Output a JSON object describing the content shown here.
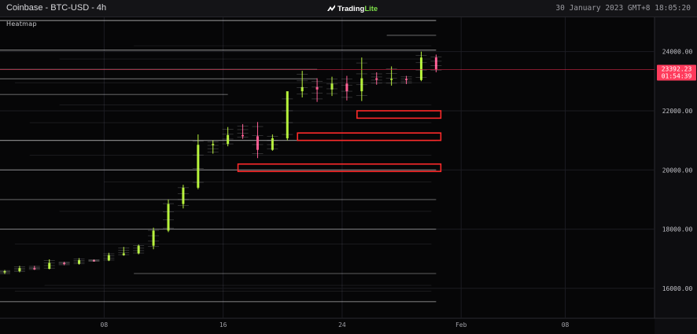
{
  "header": {
    "symbol": "Coinbase - BTC-USD - 4h",
    "logo_main": "Trading",
    "logo_accent": "Lite",
    "datetime": "30 January 2023 GMT+8 18:05:20"
  },
  "panel": {
    "title": "Heatmap"
  },
  "colors": {
    "background": "#0a0a0c",
    "up_candle": "#b6f23a",
    "down_candle": "#ff5c93",
    "highlight_box": "#ff2a2a",
    "price_line": "#d6284a",
    "current_price_bg": "#ff3b5c",
    "heat_line": "#e8e8e8"
  },
  "price_axis": {
    "ticks": [
      "24000.00",
      "22000.00",
      "20000.00",
      "18000.00",
      "16000.00"
    ],
    "current_price": "23392.23",
    "countdown": "01:54:39"
  },
  "time_axis": {
    "ticks": [
      "08",
      "16",
      "24",
      "Feb",
      "08"
    ]
  },
  "chart_data": {
    "type": "candlestick",
    "interval": "4h",
    "y_range": [
      15200,
      25000
    ],
    "x_range": [
      "2023-01-01",
      "2023-02-14"
    ],
    "current_price": 23392.23,
    "highlight_zones": [
      {
        "from": "2023-01-25",
        "to": "2023-01-30",
        "price_low": 21750,
        "price_high": 22000
      },
      {
        "from": "2023-01-21",
        "to": "2023-01-30",
        "price_low": 21000,
        "price_high": 21250
      },
      {
        "from": "2023-01-17",
        "to": "2023-01-30",
        "price_low": 19950,
        "price_high": 20200
      }
    ],
    "liquidity_levels": [
      {
        "price": 25050,
        "from": "2023-01-01",
        "to": "2023-01-30"
      },
      {
        "price": 24550,
        "from": "2023-01-27",
        "to": "2023-01-30"
      },
      {
        "price": 24050,
        "from": "2023-01-01",
        "to": "2023-01-30"
      },
      {
        "price": 23400,
        "from": "2023-01-01",
        "to": "2023-01-22"
      },
      {
        "price": 23080,
        "from": "2023-01-01",
        "to": "2023-01-22"
      },
      {
        "price": 22550,
        "from": "2023-01-01",
        "to": "2023-01-16"
      },
      {
        "price": 21000,
        "from": "2023-01-01",
        "to": "2023-01-30"
      },
      {
        "price": 20000,
        "from": "2023-01-01",
        "to": "2023-01-30"
      },
      {
        "price": 19000,
        "from": "2023-01-01",
        "to": "2023-01-30"
      },
      {
        "price": 18000,
        "from": "2023-01-01",
        "to": "2023-01-30"
      },
      {
        "price": 16500,
        "from": "2023-01-10",
        "to": "2023-01-30"
      },
      {
        "price": 15550,
        "from": "2023-01-01",
        "to": "2023-01-30"
      }
    ],
    "candles": [
      {
        "date": "2023-01-01",
        "o": 16540,
        "h": 16620,
        "l": 16480,
        "c": 16580
      },
      {
        "date": "2023-01-02",
        "o": 16580,
        "h": 16760,
        "l": 16540,
        "c": 16680
      },
      {
        "date": "2023-01-03",
        "o": 16680,
        "h": 16760,
        "l": 16620,
        "c": 16660
      },
      {
        "date": "2023-01-04",
        "o": 16660,
        "h": 16980,
        "l": 16640,
        "c": 16860
      },
      {
        "date": "2023-01-05",
        "o": 16860,
        "h": 16900,
        "l": 16780,
        "c": 16830
      },
      {
        "date": "2023-01-06",
        "o": 16830,
        "h": 17020,
        "l": 16800,
        "c": 16950
      },
      {
        "date": "2023-01-07",
        "o": 16950,
        "h": 16980,
        "l": 16900,
        "c": 16940
      },
      {
        "date": "2023-01-08",
        "o": 16940,
        "h": 17200,
        "l": 16920,
        "c": 17120
      },
      {
        "date": "2023-01-09",
        "o": 17120,
        "h": 17400,
        "l": 17100,
        "c": 17180
      },
      {
        "date": "2023-01-10",
        "o": 17180,
        "h": 17480,
        "l": 17150,
        "c": 17440
      },
      {
        "date": "2023-01-11",
        "o": 17440,
        "h": 18050,
        "l": 17320,
        "c": 17950
      },
      {
        "date": "2023-01-12",
        "o": 17950,
        "h": 19000,
        "l": 17900,
        "c": 18850
      },
      {
        "date": "2023-01-13",
        "o": 18850,
        "h": 19500,
        "l": 18700,
        "c": 19400
      },
      {
        "date": "2023-01-14",
        "o": 19400,
        "h": 21200,
        "l": 19350,
        "c": 20850
      },
      {
        "date": "2023-01-15",
        "o": 20850,
        "h": 21000,
        "l": 20550,
        "c": 20880
      },
      {
        "date": "2023-01-16",
        "o": 20880,
        "h": 21450,
        "l": 20800,
        "c": 21180
      },
      {
        "date": "2023-01-17",
        "o": 21180,
        "h": 21550,
        "l": 21050,
        "c": 21140
      },
      {
        "date": "2023-01-18",
        "o": 21140,
        "h": 21620,
        "l": 20400,
        "c": 20680
      },
      {
        "date": "2023-01-19",
        "o": 20680,
        "h": 21200,
        "l": 20650,
        "c": 21070
      },
      {
        "date": "2023-01-20",
        "o": 21070,
        "h": 22600,
        "l": 21000,
        "c": 22660
      },
      {
        "date": "2023-01-21",
        "o": 22660,
        "h": 23350,
        "l": 22450,
        "c": 22800
      },
      {
        "date": "2023-01-22",
        "o": 22800,
        "h": 23100,
        "l": 22300,
        "c": 22720
      },
      {
        "date": "2023-01-23",
        "o": 22720,
        "h": 23150,
        "l": 22500,
        "c": 22920
      },
      {
        "date": "2023-01-24",
        "o": 22920,
        "h": 23180,
        "l": 22350,
        "c": 22660
      },
      {
        "date": "2023-01-25",
        "o": 22660,
        "h": 23800,
        "l": 22330,
        "c": 23100
      },
      {
        "date": "2023-01-26",
        "o": 23100,
        "h": 23300,
        "l": 22880,
        "c": 23050
      },
      {
        "date": "2023-01-27",
        "o": 23050,
        "h": 23500,
        "l": 22850,
        "c": 23080
      },
      {
        "date": "2023-01-28",
        "o": 23080,
        "h": 23180,
        "l": 22900,
        "c": 23040
      },
      {
        "date": "2023-01-29",
        "o": 23040,
        "h": 24000,
        "l": 23000,
        "c": 23800
      },
      {
        "date": "2023-01-30",
        "o": 23800,
        "h": 23900,
        "l": 23300,
        "c": 23392
      }
    ]
  }
}
